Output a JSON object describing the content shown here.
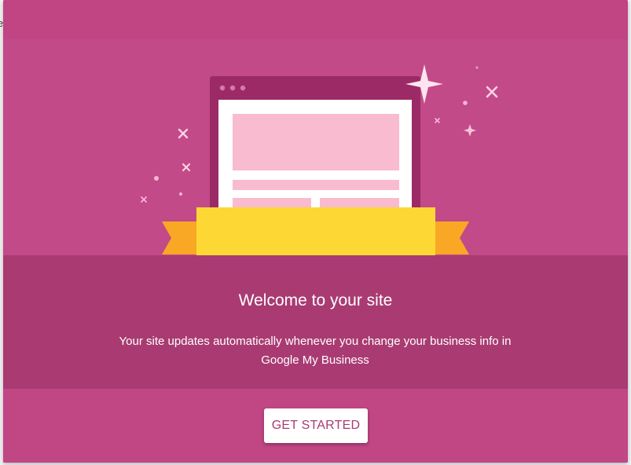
{
  "background_edge_text": "e",
  "dialog": {
    "title": "Welcome to your site",
    "description": "Your site updates automatically whenever you change your business info in Google My Business",
    "primary_button_label": "GET STARTED"
  },
  "colors": {
    "dialog_background": "#c14684",
    "text_panel_background": "#a93b72",
    "banner_yellow": "#fdd835",
    "banner_orange": "#f9a825",
    "browser_frame": "#9c2a66",
    "content_placeholder": "#f8bbd0",
    "button_text": "#a93b72"
  },
  "icons": {
    "illustration": "website-browser-illustration",
    "sparkles": "sparkle-icon"
  }
}
